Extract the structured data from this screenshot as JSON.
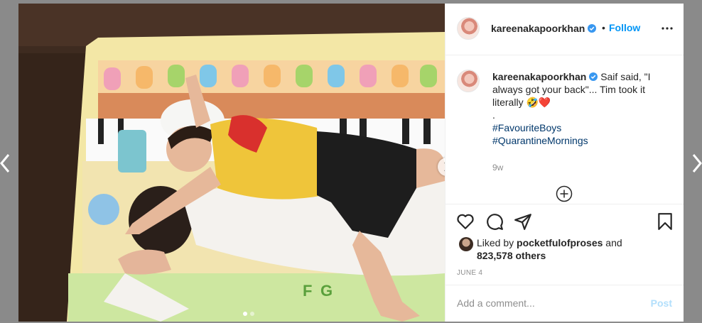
{
  "post": {
    "username": "kareenakapoorkhan",
    "follow_separator": "•",
    "follow_label": "Follow",
    "caption_username": "kareenakapoorkhan",
    "caption_text": "Saif said, \"I always got your back\"... Tim took it literally 🤣❤️",
    "caption_dot": ".",
    "hashtags": [
      "#FavouriteBoys",
      "#QuarantineMornings"
    ],
    "time_ago": "9w",
    "liked_by_prefix": "Liked by ",
    "liked_by_user": "pocketfulofproses",
    "liked_by_mid": " and",
    "liked_count": "823,578 others",
    "date": "JUNE 4",
    "comment_placeholder": "Add a comment...",
    "post_label": "Post"
  },
  "carousel": {
    "slides": 2,
    "current": 1
  },
  "colors": {
    "link": "#0095f6",
    "hashtag": "#00376b",
    "muted": "#8e8e8e",
    "post_disabled": "#b2dffc"
  },
  "icons": [
    "verified-badge-icon",
    "more-options-icon",
    "load-more-comments-icon",
    "heart-icon",
    "comment-icon",
    "share-icon",
    "save-bookmark-icon",
    "chevron-left-icon",
    "chevron-right-icon"
  ]
}
